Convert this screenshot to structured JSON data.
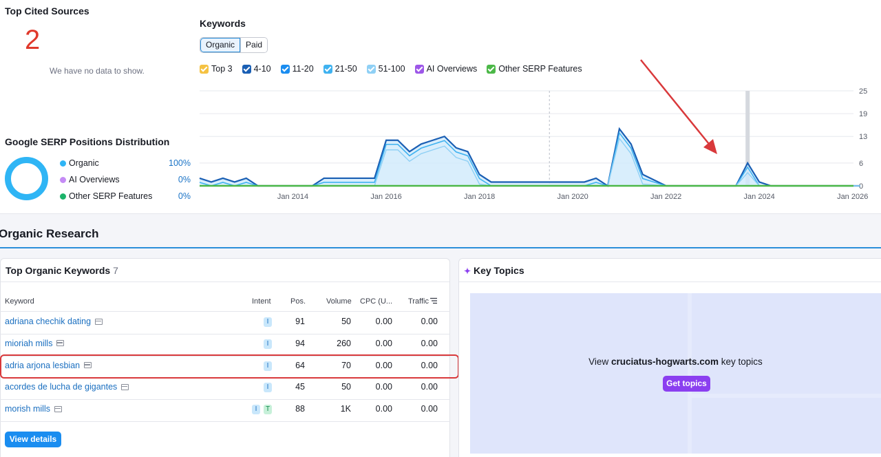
{
  "cited_sources": {
    "title": "Top Cited Sources",
    "count": "2",
    "empty_text": "We have no data to show."
  },
  "serp_distribution": {
    "title": "Google SERP Positions Distribution",
    "items": [
      {
        "label": "Organic",
        "value": "100%",
        "color": "#2fb5f5"
      },
      {
        "label": "AI Overviews",
        "value": "0%",
        "color": "#c58bf5"
      },
      {
        "label": "Other SERP Features",
        "value": "0%",
        "color": "#1bb36a"
      }
    ]
  },
  "keywords_chart": {
    "title": "Keywords",
    "tabs": [
      "Organic",
      "Paid"
    ],
    "active_tab": "Organic",
    "legend": [
      {
        "label": "Top 3",
        "color": "#f5c242"
      },
      {
        "label": "4-10",
        "color": "#1a5fb4"
      },
      {
        "label": "11-20",
        "color": "#1a8df0"
      },
      {
        "label": "21-50",
        "color": "#3fb2f0"
      },
      {
        "label": "51-100",
        "color": "#8fd0f5"
      },
      {
        "label": "AI Overviews",
        "color": "#9d57e8"
      },
      {
        "label": "Other SERP Features",
        "color": "#4cb848"
      }
    ]
  },
  "chart_data": {
    "type": "area",
    "x_ticks": [
      "Jan 2014",
      "Jan 2016",
      "Jan 2018",
      "Jan 2020",
      "Jan 2022",
      "Jan 2024",
      "Jan 2026"
    ],
    "y_ticks": [
      25,
      19,
      13,
      6,
      0
    ],
    "ylim": [
      0,
      25
    ],
    "xlim": [
      "2012-01",
      "2026-03"
    ],
    "series": [
      {
        "name": "Organic",
        "x": [
          "2012-01",
          "2012-04",
          "2012-07",
          "2012-10",
          "2013-01",
          "2013-04",
          "2014-01",
          "2014-06",
          "2014-09",
          "2015-01",
          "2015-04",
          "2015-07",
          "2015-10",
          "2016-01",
          "2016-04",
          "2016-07",
          "2016-10",
          "2017-01",
          "2017-04",
          "2017-07",
          "2017-10",
          "2018-01",
          "2018-04",
          "2018-07",
          "2019-01",
          "2019-07",
          "2020-01",
          "2020-04",
          "2020-07",
          "2020-10",
          "2021-01",
          "2021-04",
          "2021-07",
          "2022-01",
          "2022-07",
          "2023-01",
          "2023-07",
          "2023-10",
          "2024-01",
          "2024-04",
          "2024-07",
          "2025-01",
          "2025-07",
          "2026-03"
        ],
        "values": [
          2,
          1,
          2,
          1,
          2,
          0,
          0,
          0,
          2,
          2,
          2,
          2,
          2,
          12,
          12,
          9,
          11,
          12,
          13,
          10,
          9,
          3,
          1,
          1,
          1,
          1,
          1,
          1,
          2,
          0,
          15,
          11,
          3,
          0,
          0,
          0,
          0,
          6,
          1,
          0,
          0,
          0,
          0,
          0
        ]
      }
    ]
  },
  "organic_research": {
    "title": "Organic Research",
    "top_keywords": {
      "title": "Top Organic Keywords",
      "count": "7",
      "columns": [
        "Keyword",
        "Intent",
        "Pos.",
        "Volume",
        "CPC (U...",
        "Traffic"
      ],
      "rows": [
        {
          "keyword": "adriana chechik dating",
          "intent": [
            "I"
          ],
          "pos": "91",
          "volume": "50",
          "cpc": "0.00",
          "traffic": "0.00"
        },
        {
          "keyword": "mioriah mills",
          "intent": [
            "I"
          ],
          "pos": "94",
          "volume": "260",
          "cpc": "0.00",
          "traffic": "0.00"
        },
        {
          "keyword": "adria arjona lesbian",
          "intent": [
            "I"
          ],
          "pos": "64",
          "volume": "70",
          "cpc": "0.00",
          "traffic": "0.00"
        },
        {
          "keyword": "acordes de lucha de gigantes",
          "intent": [
            "I"
          ],
          "pos": "45",
          "volume": "50",
          "cpc": "0.00",
          "traffic": "0.00"
        },
        {
          "keyword": "morish mills",
          "intent": [
            "I",
            "T"
          ],
          "pos": "88",
          "volume": "1K",
          "cpc": "0.00",
          "traffic": "0.00"
        }
      ],
      "view_details": "View details"
    },
    "key_topics": {
      "title": "Key Topics",
      "message_prefix": "View",
      "domain": "cruciatus-hogwarts.com",
      "message_suffix": "key topics",
      "button": "Get topics"
    }
  },
  "colors": {
    "highlight": "#d9393b",
    "link": "#1a6fc0",
    "accent": "#1a8df0"
  }
}
